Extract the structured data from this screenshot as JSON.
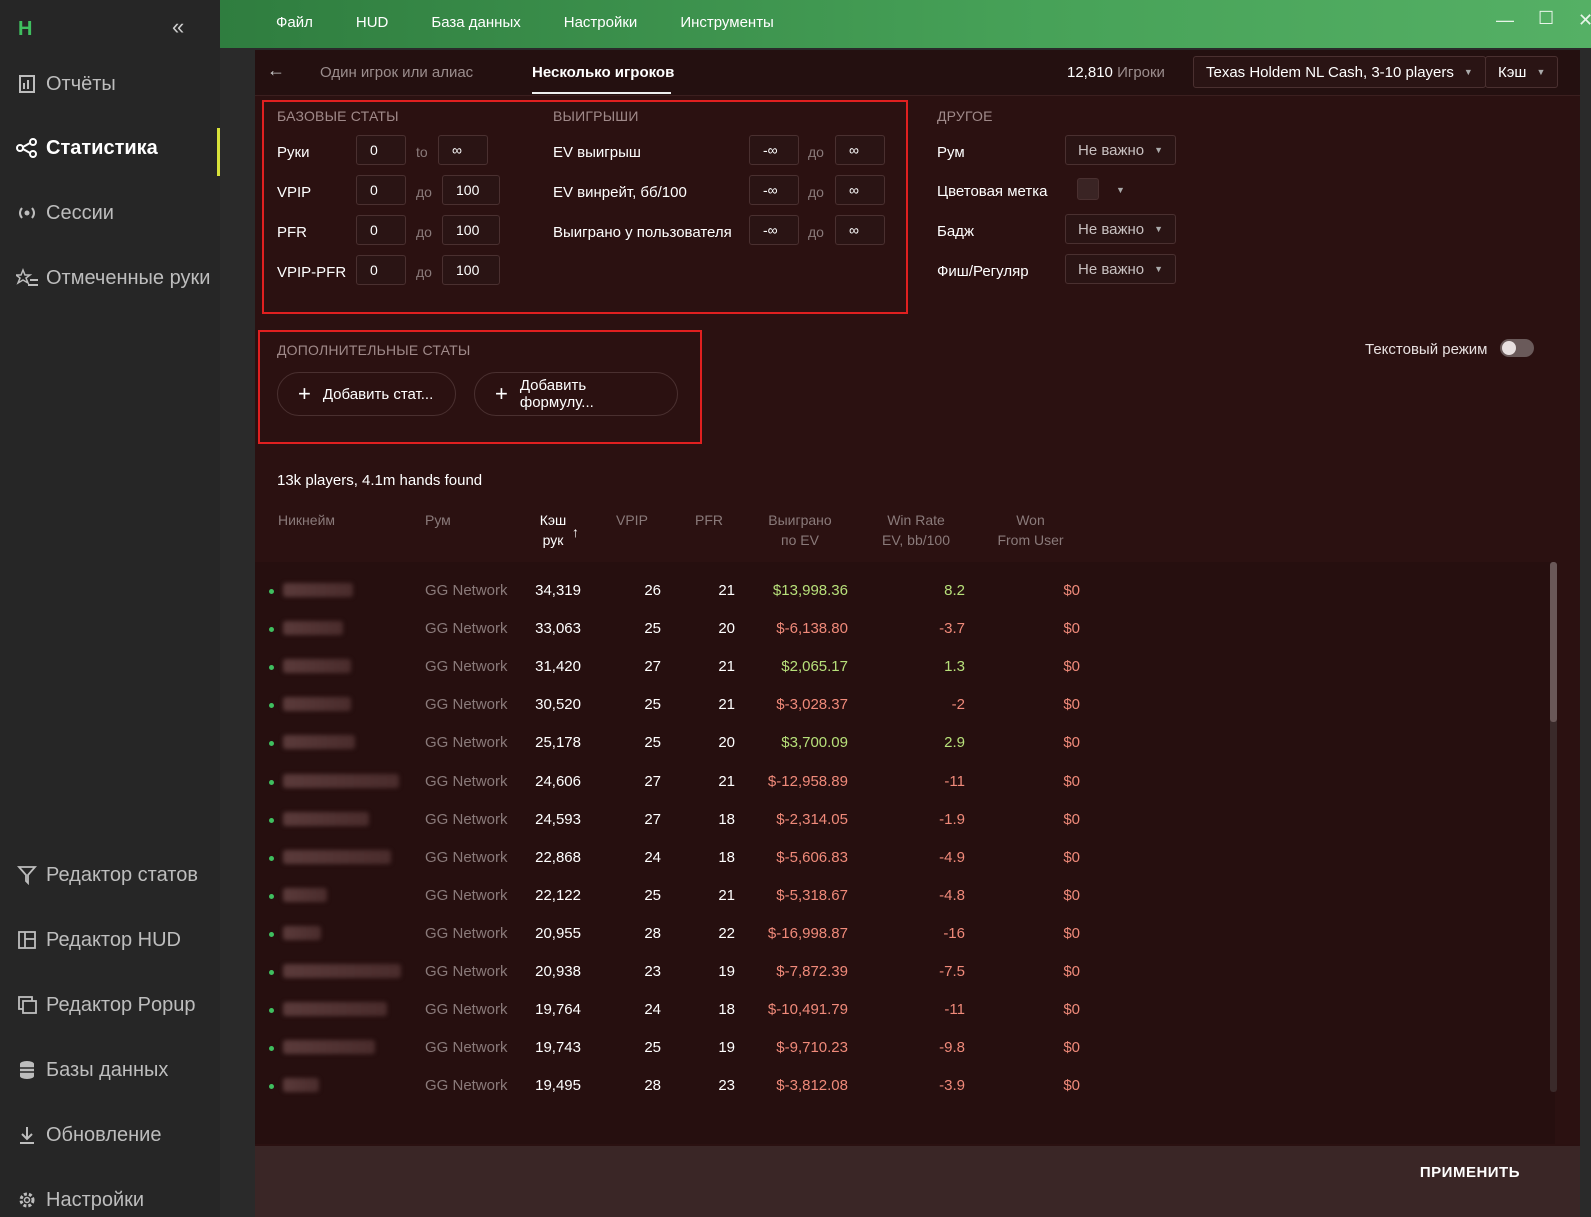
{
  "sidebar": {
    "logo": "H",
    "collapse": "«",
    "items": [
      {
        "label": "Отчёты",
        "icon": "report-icon"
      },
      {
        "label": "Статистика",
        "icon": "share-icon",
        "active": true
      },
      {
        "label": "Сессии",
        "icon": "broadcast-icon"
      },
      {
        "label": "Отмеченные руки",
        "icon": "star-list-icon"
      },
      {
        "label": "Редактор статов",
        "icon": "filter-icon"
      },
      {
        "label": "Редактор HUD",
        "icon": "hud-icon"
      },
      {
        "label": "Редактор Popup",
        "icon": "popup-icon"
      },
      {
        "label": "Базы данных",
        "icon": "database-icon"
      },
      {
        "label": "Обновление",
        "icon": "download-icon"
      },
      {
        "label": "Настройки",
        "icon": "gear-icon"
      }
    ]
  },
  "menu": [
    "Файл",
    "HUD",
    "База данных",
    "Настройки",
    "Инструменты"
  ],
  "window": {
    "minimize": "—",
    "maximize": "☐",
    "close": "✕"
  },
  "header": {
    "back": "←",
    "tab_single": "Один игрок или алиас",
    "tab_multi": "Несколько игроков",
    "players_count": "12,810",
    "players_label": "Игроки",
    "game_select": "Texas Holdem NL Cash, 3-10 players",
    "mode_select": "Кэш"
  },
  "basic": {
    "title": "БАЗОВЫЕ СТАТЫ",
    "rows": [
      {
        "label": "Руки",
        "from": "0",
        "sep": "to",
        "to": "∞"
      },
      {
        "label": "VPIP",
        "from": "0",
        "sep": "до",
        "to": "100"
      },
      {
        "label": "PFR",
        "from": "0",
        "sep": "до",
        "to": "100"
      },
      {
        "label": "VPIP-PFR",
        "from": "0",
        "sep": "до",
        "to": "100"
      }
    ]
  },
  "winnings": {
    "title": "ВЫИГРЫШИ",
    "rows": [
      {
        "label": "EV выигрыш",
        "from": "-∞",
        "sep": "до",
        "to": "∞"
      },
      {
        "label": "EV винрейт, бб/100",
        "from": "-∞",
        "sep": "до",
        "to": "∞"
      },
      {
        "label": "Выиграно у пользователя",
        "from": "-∞",
        "sep": "до",
        "to": "∞"
      }
    ]
  },
  "other": {
    "title": "ДРУГОЕ",
    "rows": [
      {
        "label": "Рум",
        "value": "Не важно"
      },
      {
        "label": "Цветовая метка",
        "value": ""
      },
      {
        "label": "Бадж",
        "value": "Не важно"
      },
      {
        "label": "Фиш/Регуляр",
        "value": "Не важно"
      }
    ]
  },
  "extra": {
    "title": "ДОПОЛНИТЕЛЬНЫЕ СТАТЫ",
    "add_stat": "Добавить стат...",
    "add_formula": "Добавить формулу..."
  },
  "text_mode": "Текстовый режим",
  "found": "13k players, 4.1m hands found",
  "columns": {
    "nick": "Никнейм",
    "room": "Рум",
    "hands_1": "Кэш",
    "hands_2": "рук",
    "sort": "↑",
    "vpip": "VPIP",
    "pfr": "PFR",
    "won_1": "Выиграно",
    "won_2": "по EV",
    "wr_1": "Win Rate",
    "wr_2": "EV, bb/100",
    "from_1": "Won",
    "from_2": "From User"
  },
  "rows": [
    {
      "room": "GG Network",
      "hands": "34,319",
      "vpip": "26",
      "pfr": "21",
      "won": "$13,998.36",
      "wr": "8.2",
      "from": "$0",
      "pos": true
    },
    {
      "room": "GG Network",
      "hands": "33,063",
      "vpip": "25",
      "pfr": "20",
      "won": "$-6,138.80",
      "wr": "-3.7",
      "from": "$0",
      "pos": false
    },
    {
      "room": "GG Network",
      "hands": "31,420",
      "vpip": "27",
      "pfr": "21",
      "won": "$2,065.17",
      "wr": "1.3",
      "from": "$0",
      "pos": true
    },
    {
      "room": "GG Network",
      "hands": "30,520",
      "vpip": "25",
      "pfr": "21",
      "won": "$-3,028.37",
      "wr": "-2",
      "from": "$0",
      "pos": false
    },
    {
      "room": "GG Network",
      "hands": "25,178",
      "vpip": "25",
      "pfr": "20",
      "won": "$3,700.09",
      "wr": "2.9",
      "from": "$0",
      "pos": true
    },
    {
      "room": "GG Network",
      "hands": "24,606",
      "vpip": "27",
      "pfr": "21",
      "won": "$-12,958.89",
      "wr": "-11",
      "from": "$0",
      "pos": false
    },
    {
      "room": "GG Network",
      "hands": "24,593",
      "vpip": "27",
      "pfr": "18",
      "won": "$-2,314.05",
      "wr": "-1.9",
      "from": "$0",
      "pos": false
    },
    {
      "room": "GG Network",
      "hands": "22,868",
      "vpip": "24",
      "pfr": "18",
      "won": "$-5,606.83",
      "wr": "-4.9",
      "from": "$0",
      "pos": false
    },
    {
      "room": "GG Network",
      "hands": "22,122",
      "vpip": "25",
      "pfr": "21",
      "won": "$-5,318.67",
      "wr": "-4.8",
      "from": "$0",
      "pos": false
    },
    {
      "room": "GG Network",
      "hands": "20,955",
      "vpip": "28",
      "pfr": "22",
      "won": "$-16,998.87",
      "wr": "-16",
      "from": "$0",
      "pos": false
    },
    {
      "room": "GG Network",
      "hands": "20,938",
      "vpip": "23",
      "pfr": "19",
      "won": "$-7,872.39",
      "wr": "-7.5",
      "from": "$0",
      "pos": false
    },
    {
      "room": "GG Network",
      "hands": "19,764",
      "vpip": "24",
      "pfr": "18",
      "won": "$-10,491.79",
      "wr": "-11",
      "from": "$0",
      "pos": false
    },
    {
      "room": "GG Network",
      "hands": "19,743",
      "vpip": "25",
      "pfr": "19",
      "won": "$-9,710.23",
      "wr": "-9.8",
      "from": "$0",
      "pos": false
    },
    {
      "room": "GG Network",
      "hands": "19,495",
      "vpip": "28",
      "pfr": "23",
      "won": "$-3,812.08",
      "wr": "-3.9",
      "from": "$0",
      "pos": false
    }
  ],
  "apply": "ПРИМЕНИТЬ"
}
